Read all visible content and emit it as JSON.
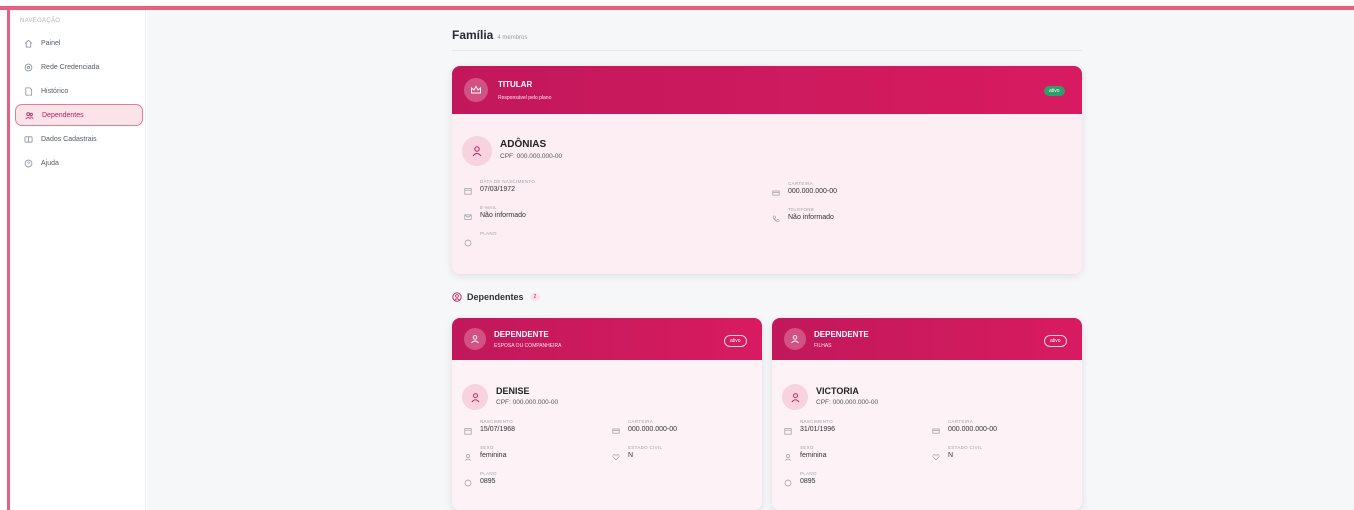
{
  "sidebar": {
    "heading": "NAVEGAÇÃO",
    "items": [
      {
        "label": "Painel",
        "icon": "home-icon"
      },
      {
        "label": "Rede Credenciada",
        "icon": "location-icon"
      },
      {
        "label": "Histórico",
        "icon": "document-icon"
      },
      {
        "label": "Dependentes",
        "icon": "users-icon",
        "active": true
      },
      {
        "label": "Dados Cadastrais",
        "icon": "id-card-icon"
      },
      {
        "label": "Ajuda",
        "icon": "help-icon"
      }
    ]
  },
  "page": {
    "title": "Família",
    "member_count": "4 membros"
  },
  "titular": {
    "header_title": "TITULAR",
    "header_subtitle": "Responsável pelo plano",
    "status": "ativo",
    "name": "ADÔNIAS",
    "cpf": "CPF: 000.000.000-00",
    "fields": {
      "birth_label": "DATA DE NASCIMENTO",
      "birth_value": "07/03/1972",
      "card_label": "CARTEIRA",
      "card_value": "000.000.000-00",
      "email_label": "E-MAIL",
      "email_value": "Não informado",
      "phone_label": "TELEFONE",
      "phone_value": "Não informado",
      "plan_label": "PLANO"
    }
  },
  "dependents_section": {
    "title": "Dependentes",
    "count": "2"
  },
  "dependents": [
    {
      "header_title": "DEPENDENTE",
      "header_subtitle": "ESPOSA OU COMPANHEIRA",
      "status": "ativo",
      "name": "DENISE",
      "cpf": "CPF: 000.000.000-00",
      "birth_label": "NASCIMENTO",
      "birth_value": "15/07/1968",
      "card_label": "CARTEIRA",
      "card_value": "000.000.000-00",
      "sex_label": "SEXO",
      "sex_value": "feminina",
      "civil_label": "ESTADO CIVIL",
      "civil_value": "N",
      "plan_label": "PLANO",
      "plan_value": "0895"
    },
    {
      "header_title": "DEPENDENTE",
      "header_subtitle": "FILHAS",
      "status": "ativo",
      "name": "VICTORIA",
      "cpf": "CPF: 000.000.000-00",
      "birth_label": "NASCIMENTO",
      "birth_value": "31/01/1996",
      "card_label": "CARTEIRA",
      "card_value": "000.000.000-00",
      "sex_label": "SEXO",
      "sex_value": "feminina",
      "civil_label": "ESTADO CIVIL",
      "civil_value": "N",
      "plan_label": "PLANO",
      "plan_value": "0895"
    }
  ],
  "colors": {
    "accent": "#c2185b",
    "frame": "#e8607e",
    "status_green": "#2e9e6a"
  }
}
